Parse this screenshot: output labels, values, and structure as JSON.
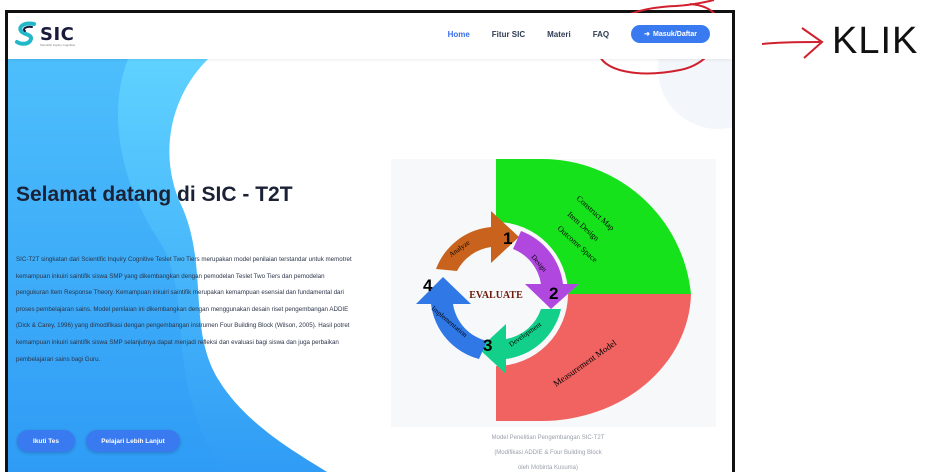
{
  "navbar": {
    "logo_text": "SIC",
    "logo_tagline": "Scientific Inquiry Cognitive",
    "links": [
      "Home",
      "Fitur SIC",
      "Materi",
      "FAQ"
    ],
    "login_label": "Masuk/Daftar",
    "login_icon": "sign-in-icon"
  },
  "hero": {
    "title": "Selamat datang di SIC - T2T",
    "description": "SIC-T2T singkatan dari Scientific Inquiry Cognitive Teslet Two Tiers merupakan model penilaian terstandar untuk memotret kemampuan inkuiri saintifik siswa SMP yang dikembangkan dengan pemodelan Teslet Two Tiers dan pemodelan pengukuran Item Response Theory. Kemampuan inkuiri saintifik merupakan kemampuan esensial dan fundamental dari proses pembelajaran sains. Model penilaian ini dikembangkan dengan menggunakan desain riset pengembangan ADDIE (Dick & Carey, 1996) yang dimodifikasi dengan pengembangan instrumen Four Building Block (Wilson, 2005). Hasil potret kemampuan inkuiri saintifik siswa SMP selanjutnya dapat menjadi refleksi dan evaluasi bagi siswa dan juga perbaikan pembelajaran sains bagi Guru.",
    "button_test": "Ikuti Tes",
    "button_learn": "Pelajari Lebih Lanjut"
  },
  "diagram": {
    "center": "EVALUATE",
    "steps": [
      {
        "num": "1",
        "label": "Analyze"
      },
      {
        "num": "2",
        "label": "Design"
      },
      {
        "num": "3",
        "label": "Development"
      },
      {
        "num": "4",
        "label": "Implementation"
      }
    ],
    "outer_top": [
      "Construct Map",
      "Item Design",
      "Outcome Space"
    ],
    "outer_bottom": "Measurement Model",
    "caption": [
      "Model Penelitian Pengembangan SIC-T2T",
      "(Modifikasi ADDIE & Four Building Block",
      "oleh Mobinta Kusuma)"
    ]
  },
  "annotation": {
    "text": "KLIK"
  },
  "colors": {
    "accent": "#3a7af0",
    "annotation_red": "#d0202e"
  }
}
